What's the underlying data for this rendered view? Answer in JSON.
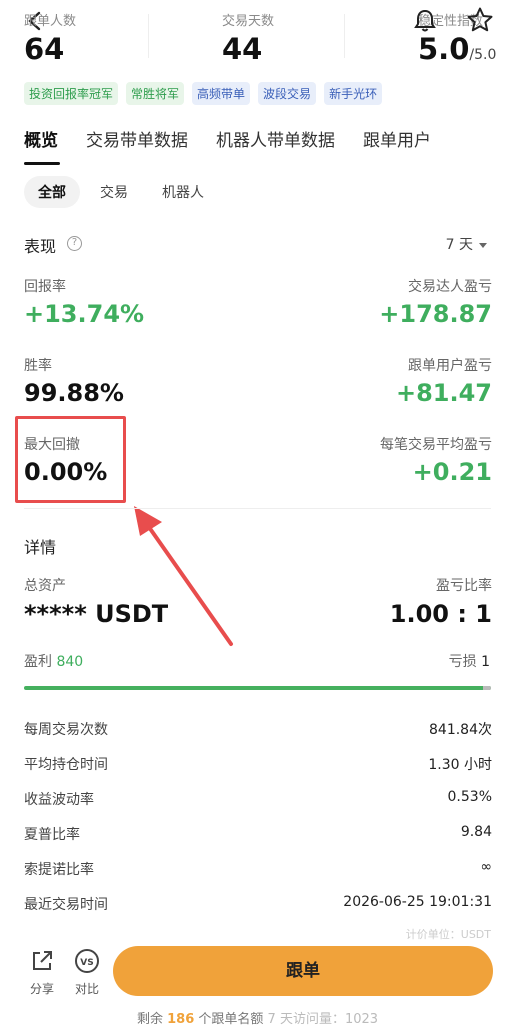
{
  "header": {
    "stats": [
      {
        "label": "跟单人数",
        "value": "64"
      },
      {
        "label": "交易天数",
        "value": "44"
      },
      {
        "label": "稳定性指数",
        "value": "5.0",
        "suffix": "/5.0"
      }
    ]
  },
  "tags": [
    "投资回报率冠军",
    "常胜将军",
    "高频带单",
    "波段交易",
    "新手光环"
  ],
  "tabs": [
    "概览",
    "交易带单数据",
    "机器人带单数据",
    "跟单用户"
  ],
  "subtabs": [
    "全部",
    "交易",
    "机器人"
  ],
  "performance": {
    "title": "表现",
    "period": "7 天",
    "return_label": "回报率",
    "return_value": "+13.74%",
    "trader_pnl_label": "交易达人盈亏",
    "trader_pnl_value": "+178.87",
    "winrate_label": "胜率",
    "winrate_value": "99.88%",
    "follower_pnl_label": "跟单用户盈亏",
    "follower_pnl_value": "+81.47",
    "drawdown_label": "最大回撤",
    "drawdown_value": "0.00%",
    "avg_pnl_label": "每笔交易平均盈亏",
    "avg_pnl_value": "+0.21"
  },
  "details": {
    "title": "详情",
    "assets_label": "总资产",
    "assets_value": "***** USDT",
    "ratio_label": "盈亏比率",
    "ratio_value": "1.00 : 1",
    "profit_label": "盈利",
    "profit_count": "840",
    "loss_label": "亏损",
    "loss_count": "1",
    "profit_fraction": 0.9988,
    "rows": [
      {
        "k": "每周交易次数",
        "v": "841.84次"
      },
      {
        "k": "平均持仓时间",
        "v": "1.30 小时"
      },
      {
        "k": "收益波动率",
        "v": "0.53%"
      },
      {
        "k": "夏普比率",
        "v": "9.84"
      },
      {
        "k": "索提诺比率",
        "v": "∞"
      },
      {
        "k": "最近交易时间",
        "v": "2026-06-25 19:01:31"
      }
    ],
    "unit_note": "计价单位：USDT"
  },
  "bottom": {
    "share_label": "分享",
    "compare_label": "对比",
    "follow_label": "跟单",
    "quota_prefix": "剩余",
    "quota_num": "186",
    "quota_suffix": "个跟单名额",
    "visits": "7 天访问量：1023"
  },
  "colors": {
    "accent": "#f0a23a",
    "positive": "#3fae5e",
    "highlight": "#e84d4d"
  }
}
